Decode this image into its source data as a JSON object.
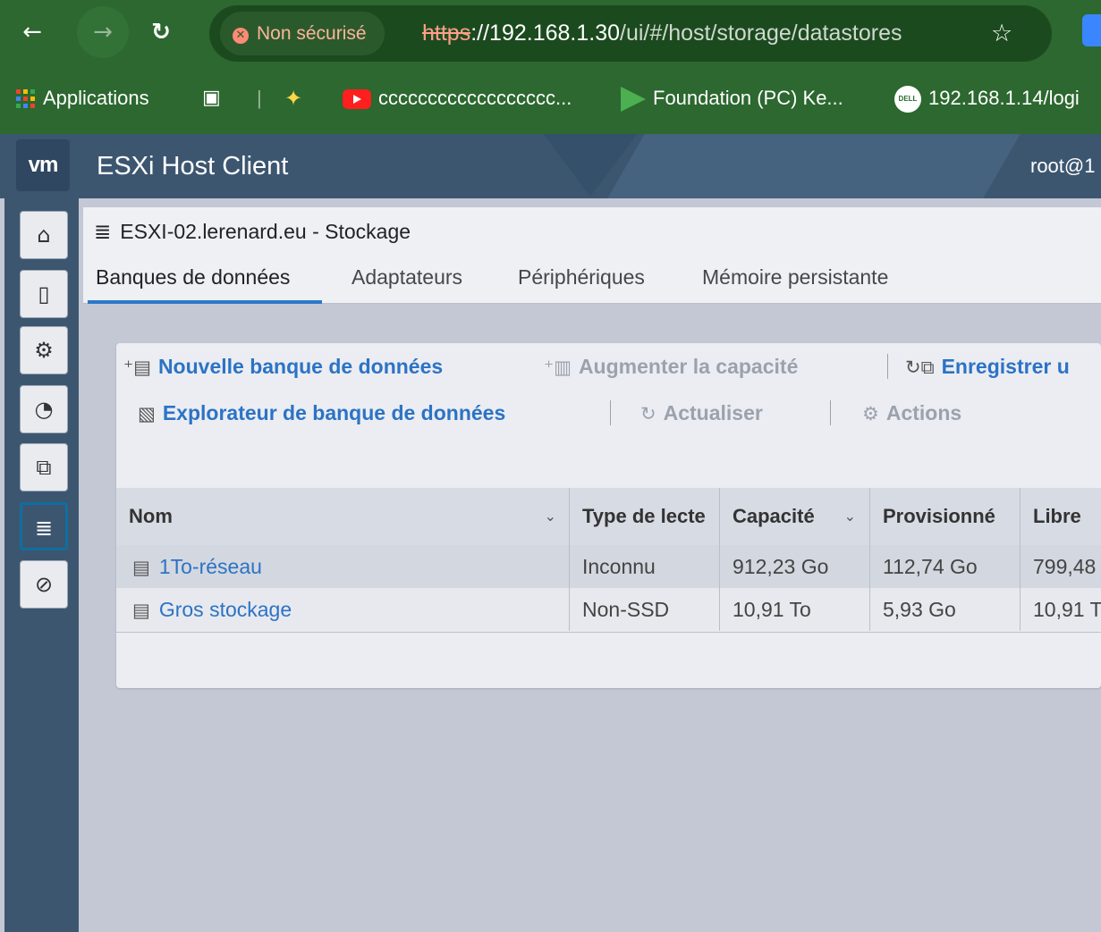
{
  "browser": {
    "security_label": "Non sécurisé",
    "url_protocol": "https",
    "url_host": "://192.168.1.30",
    "url_path": "/ui/#/host/storage/datastores",
    "bookmarks": {
      "apps": "Applications",
      "youtube": "cccccccccccccccccc...",
      "foundation": "Foundation (PC) Ke...",
      "dell": "192.168.1.14/logi"
    }
  },
  "header": {
    "logo": "vm",
    "app_title": "ESXi Host Client",
    "user": "root@1"
  },
  "sidebar": {
    "items": [
      "home-icon",
      "host-icon",
      "manage-icon",
      "monitor-icon",
      "virtual-machines-icon",
      "storage-icon",
      "networking-icon"
    ],
    "active": "storage"
  },
  "page": {
    "title": "ESXI-02.lerenard.eu - Stockage",
    "tabs": [
      "Banques de données",
      "Adaptateurs",
      "Périphériques",
      "Mémoire persistante"
    ],
    "active_tab": 0
  },
  "toolbar": {
    "new_datastore": "Nouvelle banque de données",
    "increase_capacity": "Augmenter la capacité",
    "register": "Enregistrer u",
    "datastore_browser": "Explorateur de banque de données",
    "refresh": "Actualiser",
    "actions": "Actions"
  },
  "table": {
    "columns": [
      "Nom",
      "Type de lecte",
      "Capacité",
      "Provisionné",
      "Libre"
    ],
    "rows": [
      {
        "name": "1To-réseau",
        "type": "Inconnu",
        "capacity": "912,23 Go",
        "provisioned": "112,74 Go",
        "free": "799,48"
      },
      {
        "name": "Gros stockage",
        "type": "Non-SSD",
        "capacity": "10,91 To",
        "provisioned": "5,93 Go",
        "free": "10,91 T"
      }
    ]
  },
  "colors": {
    "browser_green": "#2c682f",
    "esxi_header": "#3d5670",
    "link_blue": "#2c73c5"
  }
}
